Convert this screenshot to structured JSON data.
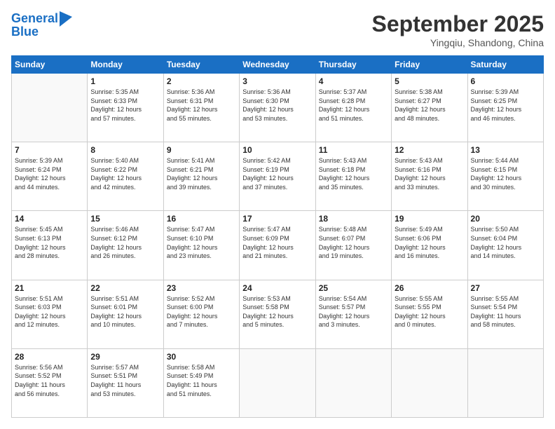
{
  "logo": {
    "line1": "General",
    "line2": "Blue"
  },
  "title": "September 2025",
  "location": "Yingqiu, Shandong, China",
  "weekdays": [
    "Sunday",
    "Monday",
    "Tuesday",
    "Wednesday",
    "Thursday",
    "Friday",
    "Saturday"
  ],
  "weeks": [
    [
      {
        "day": "",
        "info": ""
      },
      {
        "day": "1",
        "info": "Sunrise: 5:35 AM\nSunset: 6:33 PM\nDaylight: 12 hours\nand 57 minutes."
      },
      {
        "day": "2",
        "info": "Sunrise: 5:36 AM\nSunset: 6:31 PM\nDaylight: 12 hours\nand 55 minutes."
      },
      {
        "day": "3",
        "info": "Sunrise: 5:36 AM\nSunset: 6:30 PM\nDaylight: 12 hours\nand 53 minutes."
      },
      {
        "day": "4",
        "info": "Sunrise: 5:37 AM\nSunset: 6:28 PM\nDaylight: 12 hours\nand 51 minutes."
      },
      {
        "day": "5",
        "info": "Sunrise: 5:38 AM\nSunset: 6:27 PM\nDaylight: 12 hours\nand 48 minutes."
      },
      {
        "day": "6",
        "info": "Sunrise: 5:39 AM\nSunset: 6:25 PM\nDaylight: 12 hours\nand 46 minutes."
      }
    ],
    [
      {
        "day": "7",
        "info": "Sunrise: 5:39 AM\nSunset: 6:24 PM\nDaylight: 12 hours\nand 44 minutes."
      },
      {
        "day": "8",
        "info": "Sunrise: 5:40 AM\nSunset: 6:22 PM\nDaylight: 12 hours\nand 42 minutes."
      },
      {
        "day": "9",
        "info": "Sunrise: 5:41 AM\nSunset: 6:21 PM\nDaylight: 12 hours\nand 39 minutes."
      },
      {
        "day": "10",
        "info": "Sunrise: 5:42 AM\nSunset: 6:19 PM\nDaylight: 12 hours\nand 37 minutes."
      },
      {
        "day": "11",
        "info": "Sunrise: 5:43 AM\nSunset: 6:18 PM\nDaylight: 12 hours\nand 35 minutes."
      },
      {
        "day": "12",
        "info": "Sunrise: 5:43 AM\nSunset: 6:16 PM\nDaylight: 12 hours\nand 33 minutes."
      },
      {
        "day": "13",
        "info": "Sunrise: 5:44 AM\nSunset: 6:15 PM\nDaylight: 12 hours\nand 30 minutes."
      }
    ],
    [
      {
        "day": "14",
        "info": "Sunrise: 5:45 AM\nSunset: 6:13 PM\nDaylight: 12 hours\nand 28 minutes."
      },
      {
        "day": "15",
        "info": "Sunrise: 5:46 AM\nSunset: 6:12 PM\nDaylight: 12 hours\nand 26 minutes."
      },
      {
        "day": "16",
        "info": "Sunrise: 5:47 AM\nSunset: 6:10 PM\nDaylight: 12 hours\nand 23 minutes."
      },
      {
        "day": "17",
        "info": "Sunrise: 5:47 AM\nSunset: 6:09 PM\nDaylight: 12 hours\nand 21 minutes."
      },
      {
        "day": "18",
        "info": "Sunrise: 5:48 AM\nSunset: 6:07 PM\nDaylight: 12 hours\nand 19 minutes."
      },
      {
        "day": "19",
        "info": "Sunrise: 5:49 AM\nSunset: 6:06 PM\nDaylight: 12 hours\nand 16 minutes."
      },
      {
        "day": "20",
        "info": "Sunrise: 5:50 AM\nSunset: 6:04 PM\nDaylight: 12 hours\nand 14 minutes."
      }
    ],
    [
      {
        "day": "21",
        "info": "Sunrise: 5:51 AM\nSunset: 6:03 PM\nDaylight: 12 hours\nand 12 minutes."
      },
      {
        "day": "22",
        "info": "Sunrise: 5:51 AM\nSunset: 6:01 PM\nDaylight: 12 hours\nand 10 minutes."
      },
      {
        "day": "23",
        "info": "Sunrise: 5:52 AM\nSunset: 6:00 PM\nDaylight: 12 hours\nand 7 minutes."
      },
      {
        "day": "24",
        "info": "Sunrise: 5:53 AM\nSunset: 5:58 PM\nDaylight: 12 hours\nand 5 minutes."
      },
      {
        "day": "25",
        "info": "Sunrise: 5:54 AM\nSunset: 5:57 PM\nDaylight: 12 hours\nand 3 minutes."
      },
      {
        "day": "26",
        "info": "Sunrise: 5:55 AM\nSunset: 5:55 PM\nDaylight: 12 hours\nand 0 minutes."
      },
      {
        "day": "27",
        "info": "Sunrise: 5:55 AM\nSunset: 5:54 PM\nDaylight: 11 hours\nand 58 minutes."
      }
    ],
    [
      {
        "day": "28",
        "info": "Sunrise: 5:56 AM\nSunset: 5:52 PM\nDaylight: 11 hours\nand 56 minutes."
      },
      {
        "day": "29",
        "info": "Sunrise: 5:57 AM\nSunset: 5:51 PM\nDaylight: 11 hours\nand 53 minutes."
      },
      {
        "day": "30",
        "info": "Sunrise: 5:58 AM\nSunset: 5:49 PM\nDaylight: 11 hours\nand 51 minutes."
      },
      {
        "day": "",
        "info": ""
      },
      {
        "day": "",
        "info": ""
      },
      {
        "day": "",
        "info": ""
      },
      {
        "day": "",
        "info": ""
      }
    ]
  ]
}
